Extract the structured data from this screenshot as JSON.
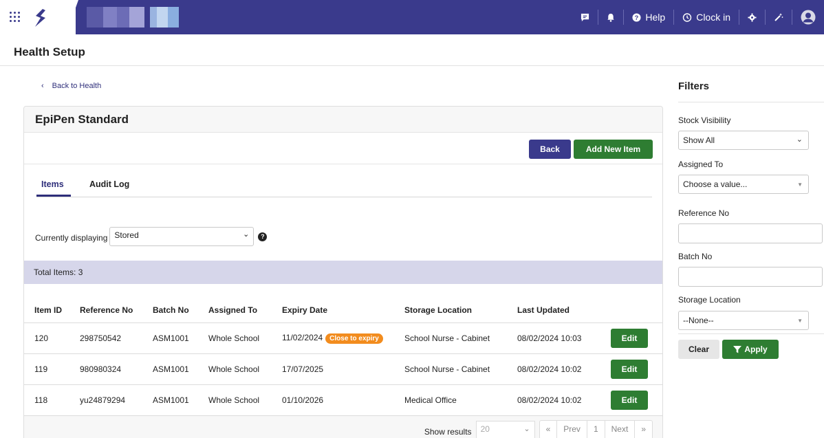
{
  "topbar": {
    "help_label": "Help",
    "clockin_label": "Clock in",
    "colors": {
      "bar": "#3a3a8c",
      "brand": "#3a3a8c"
    },
    "icons": [
      "apps-grid-icon",
      "brand-logo",
      "chat-icon",
      "bell-icon",
      "help-icon",
      "clock-icon",
      "gear-icon",
      "magic-wand-icon",
      "avatar-icon"
    ]
  },
  "page": {
    "title": "Health Setup"
  },
  "back": {
    "label": "Back to Health",
    "chevron": "‹"
  },
  "card": {
    "title": "EpiPen Standard",
    "back_button": "Back",
    "add_button": "Add New Item",
    "tabs": [
      {
        "label": "Items"
      },
      {
        "label": "Audit Log"
      }
    ],
    "display_label": "Currently displaying",
    "display_value": "Stored",
    "total_label": "Total Items: 3",
    "columns": [
      "Item ID",
      "Reference No",
      "Batch No",
      "Assigned To",
      "Expiry Date",
      "Storage Location",
      "Last Updated"
    ],
    "rows": [
      {
        "id": "120",
        "ref": "298750542",
        "batch": "ASM1001",
        "assigned": "Whole School",
        "expiry": "11/02/2024",
        "badge": "Close to expiry",
        "storage": "School Nurse - Cabinet",
        "updated": "08/02/2024 10:03",
        "action": "Edit"
      },
      {
        "id": "119",
        "ref": "980980324",
        "batch": "ASM1001",
        "assigned": "Whole School",
        "expiry": "17/07/2025",
        "badge": "",
        "storage": "School Nurse - Cabinet",
        "updated": "08/02/2024 10:02",
        "action": "Edit"
      },
      {
        "id": "118",
        "ref": "yu24879294",
        "batch": "ASM1001",
        "assigned": "Whole School",
        "expiry": "01/10/2026",
        "badge": "",
        "storage": "Medical Office",
        "updated": "08/02/2024 10:02",
        "action": "Edit"
      }
    ],
    "pager": {
      "show_label": "Show results",
      "per_page": "20",
      "first": "«",
      "prev": "Prev",
      "page": "1",
      "next": "Next",
      "last": "»"
    }
  },
  "filters": {
    "title": "Filters",
    "stock_label": "Stock Visibility",
    "stock_value": "Show All",
    "assigned_label": "Assigned To",
    "assigned_placeholder": "Choose a value...",
    "ref_label": "Reference No",
    "batch_label": "Batch No",
    "storage_label": "Storage Location",
    "storage_value": "--None--",
    "clear_label": "Clear",
    "apply_label": "Apply"
  }
}
